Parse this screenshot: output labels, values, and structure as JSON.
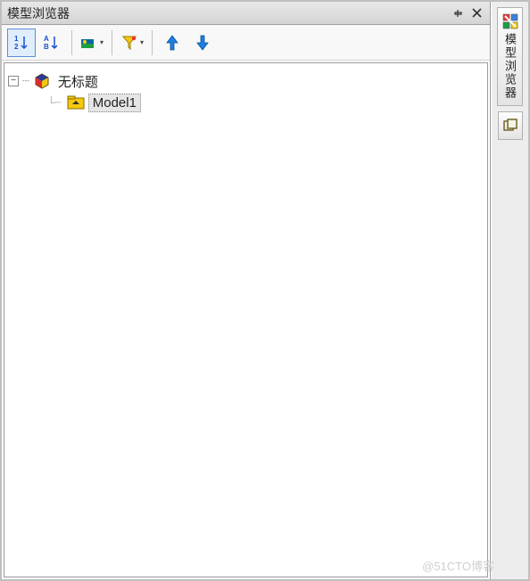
{
  "panel": {
    "title": "模型浏览器"
  },
  "toolbar": {
    "sort_numeric": "1 2",
    "sort_alpha": "A B"
  },
  "tree": {
    "root_label": "无标题",
    "child_label": "Model1"
  },
  "side": {
    "tab1_label": "模型浏览器"
  },
  "watermark": "@51CTO博客"
}
